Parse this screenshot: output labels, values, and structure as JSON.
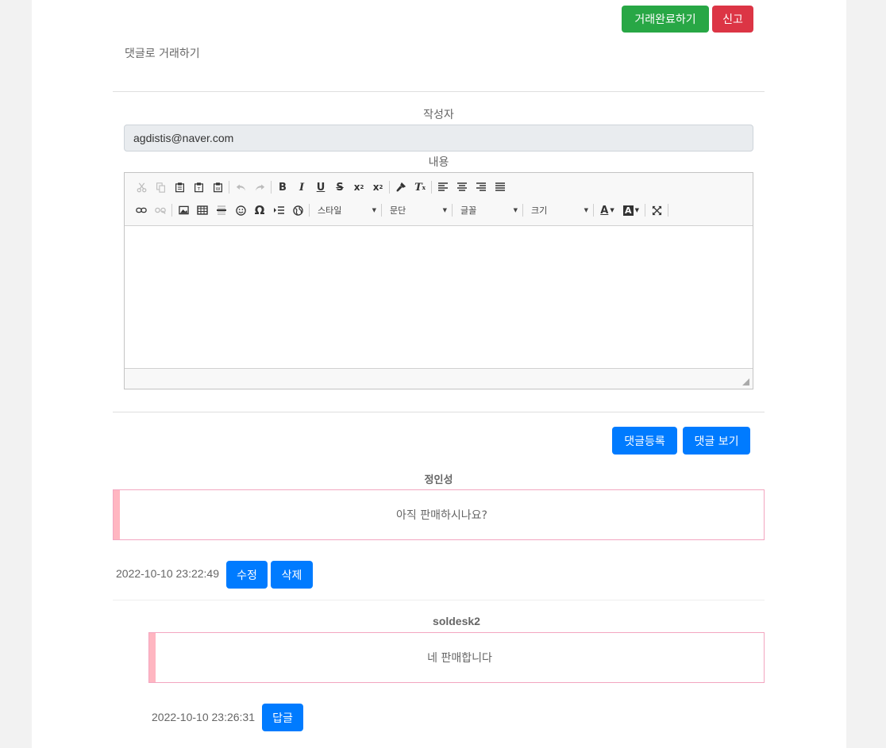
{
  "header": {
    "complete_button": "거래완료하기",
    "report_button": "신고",
    "subtitle": "댓글로 거래하기"
  },
  "form": {
    "author_label": "작성자",
    "author_value": "agdistis@naver.com",
    "content_label": "내용"
  },
  "editor": {
    "style_combo": "스타일",
    "format_combo": "문단",
    "font_combo": "글꼴",
    "size_combo": "크기"
  },
  "actions": {
    "register_button": "댓글등록",
    "view_button": "댓글 보기"
  },
  "comments": [
    {
      "author": "정인성",
      "text": "아직 판매하시나요?",
      "timestamp": "2022-10-10 23:22:49",
      "edit_button": "수정",
      "delete_button": "삭제"
    },
    {
      "author": "soldesk2",
      "text": "네 판매합니다",
      "timestamp": "2022-10-10 23:26:31",
      "reply_button": "답글"
    }
  ],
  "colors": {
    "green": "#28a745",
    "red": "#dc3545",
    "blue": "#007bff",
    "comment_bar": "#ffb6c1",
    "comment_border": "#f3a6c0"
  }
}
